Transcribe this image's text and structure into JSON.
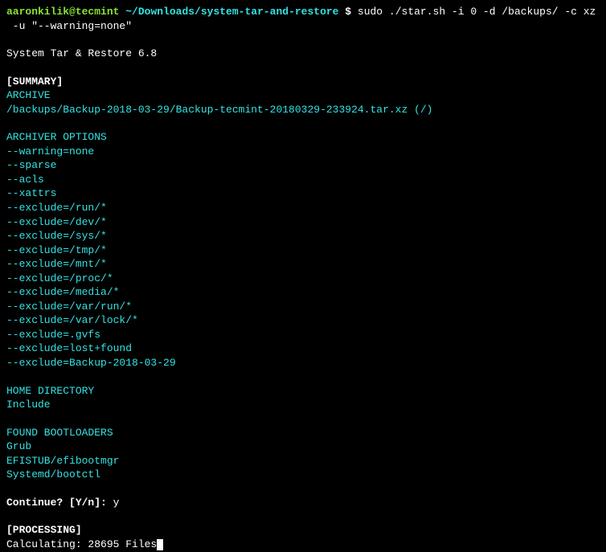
{
  "prompt": {
    "user_host": "aaronkilik@tecmint",
    "path": " ~/Downloads/system-tar-and-restore ",
    "symbol": "$ ",
    "command_line1": "sudo ./star.sh -i 0 -d /backups/ -c xz",
    "command_line2": " -u \"--warning=none\""
  },
  "header": "System Tar & Restore 6.8",
  "summary": {
    "title": "[SUMMARY]",
    "archive_label": "ARCHIVE",
    "archive_path": "/backups/Backup-2018-03-29/Backup-tecmint-20180329-233924.tar.xz (/)",
    "archiver_options_label": "ARCHIVER OPTIONS",
    "options": [
      "--warning=none",
      "--sparse",
      "--acls",
      "--xattrs",
      "--exclude=/run/*",
      "--exclude=/dev/*",
      "--exclude=/sys/*",
      "--exclude=/tmp/*",
      "--exclude=/mnt/*",
      "--exclude=/proc/*",
      "--exclude=/media/*",
      "--exclude=/var/run/*",
      "--exclude=/var/lock/*",
      "--exclude=.gvfs",
      "--exclude=lost+found",
      "--exclude=Backup-2018-03-29"
    ],
    "home_dir_label": "HOME DIRECTORY",
    "home_dir_value": "Include",
    "bootloaders_label": "FOUND BOOTLOADERS",
    "bootloaders": [
      "Grub",
      "EFISTUB/efibootmgr",
      "Systemd/bootctl"
    ]
  },
  "continue": {
    "prompt": "Continue? [Y/n]: ",
    "answer": "y"
  },
  "processing": {
    "title": "[PROCESSING]",
    "status": "Calculating: 28695 Files"
  }
}
